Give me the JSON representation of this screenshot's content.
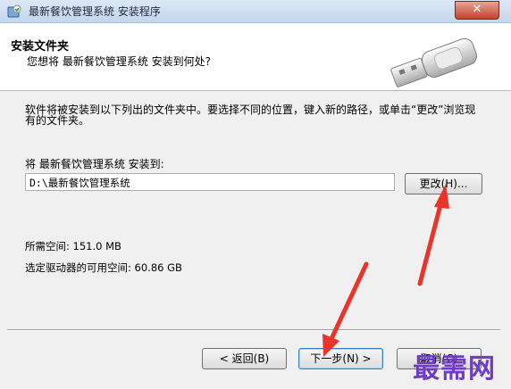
{
  "window": {
    "title": "最新餐饮管理系统 安装程序",
    "close_label": "✕"
  },
  "header": {
    "title": "安装文件夹",
    "subtitle": "您想将 最新餐饮管理系统 安装到何处?",
    "icon": "usb-drive-icon"
  },
  "main": {
    "description": "软件将被安装到以下列出的文件夹中。要选择不同的位置，键入新的路径，或单击“更改”浏览现有的文件夹。",
    "install_label": "将 最新餐饮管理系统 安装到:",
    "path_value": "D:\\最新餐饮管理系统",
    "browse_label": "更改(H)...",
    "required_space": "所需空间: 151.0 MB",
    "available_space": "选定驱动器的可用空间: 60.86 GB"
  },
  "footer": {
    "back_label": "< 返回(B)",
    "next_label": "下一步(N) >",
    "cancel_label": "取消(C)"
  },
  "watermark": "最需网",
  "colors": {
    "arrow": "#e8342a",
    "watermark": "#6f3dbf"
  }
}
